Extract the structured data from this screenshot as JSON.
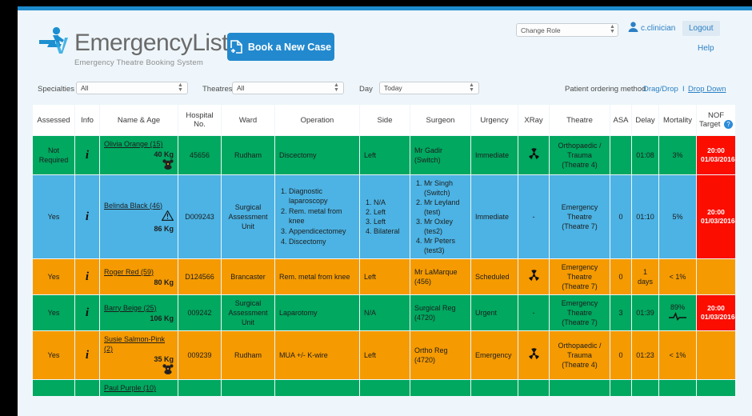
{
  "brand": {
    "name_part1": "Emergency",
    "name_part2": "List",
    "tagline": "Emergency Theatre Booking System",
    "accent_color": "#1e8bcd"
  },
  "header": {
    "book_button": "Book a New Case",
    "role_select_value": "Change Role",
    "username": "c.clinician",
    "logout_label": "Logout",
    "help_label": "Help"
  },
  "filters": {
    "specialties_label": "Specialties",
    "specialties_value": "All",
    "theatres_label": "Theatres",
    "theatres_value": "All",
    "day_label": "Day",
    "day_value": "Today",
    "ordering_label": "Patient ordering method",
    "ordering_dragdrop": "Drag/Drop",
    "ordering_separator": "I",
    "ordering_dropdown": "Drop Down"
  },
  "table": {
    "columns": [
      "Assessed",
      "Info",
      "Name & Age",
      "Hospital No.",
      "Ward",
      "Operation",
      "Side",
      "Surgeon",
      "Urgency",
      "XRay",
      "Theatre",
      "ASA",
      "Delay",
      "Mortality",
      "NOF Target"
    ],
    "rows": [
      {
        "color": "green",
        "assessed": "Not Required",
        "info_icon": "info-italic-i",
        "name": "Olivia Orange (15)",
        "weight": "40 Kg",
        "flag_icon": "teddy-bear-icon",
        "hospital_no": "45656",
        "ward": "Rudham",
        "operation": "Discectomy",
        "side": "Left",
        "surgeon": "Mr Gadir (Switch)",
        "urgency": "Immediate",
        "xray": "radiation-icon",
        "theatre": "Orthopaedic / Trauma (Theatre 4)",
        "asa": "",
        "delay": "01:08",
        "mortality": "3%",
        "mortality_icon": "",
        "nof_target": "20:00 01/03/2016",
        "nof_time": "20:00",
        "nof_date": "01/03/2016"
      },
      {
        "color": "blue",
        "assessed": "Yes",
        "info_icon": "info-italic-i",
        "name": "Belinda Black (46)",
        "weight": "86 Kg",
        "flag_icon": "warning-triangle-icon",
        "hospital_no": "D009243",
        "ward": "Surgical Assessment Unit",
        "operations": [
          "Diagnostic laparoscopy",
          "Rem. metal from knee",
          "Appendicectomey",
          "Discectomy"
        ],
        "sides": [
          "N/A",
          "Left",
          "Left",
          "Bilateral"
        ],
        "surgeons": [
          "Mr Singh (Switch)",
          "Mr Leyland (test)",
          "Mr Oxley (tes2)",
          "Mr Peters (test3)"
        ],
        "urgency": "Immediate",
        "xray": "-",
        "theatre": "Emergency Theatre (Theatre 7)",
        "asa": "0",
        "delay": "01:10",
        "mortality": "5%",
        "mortality_icon": "",
        "nof_time": "20:00",
        "nof_date": "01/03/2016"
      },
      {
        "color": "orange",
        "assessed": "Yes",
        "info_icon": "info-italic-i",
        "name": "Roger Red (59)",
        "weight": "80 Kg",
        "flag_icon": "",
        "hospital_no": "D124566",
        "ward": "Brancaster",
        "operation": "Rem. metal from knee",
        "side": "Left",
        "surgeon": "Mr LaMarque (456)",
        "urgency": "Scheduled",
        "xray": "radiation-icon",
        "theatre": "Emergency Theatre (Theatre 7)",
        "asa": "0",
        "delay": "1 days",
        "mortality": "< 1%",
        "mortality_icon": "",
        "nof_time": "",
        "nof_date": ""
      },
      {
        "color": "green",
        "assessed": "Yes",
        "info_icon": "info-italic-i",
        "name": "Barry Beige (25)",
        "weight": "106 Kg",
        "flag_icon": "",
        "hospital_no": "009242",
        "ward": "Surgical Assessment Unit",
        "operation": "Laparotomy",
        "side": "N/A",
        "surgeon": "Surgical Reg (4720)",
        "urgency": "Urgent",
        "xray": "-",
        "theatre": "Emergency Theatre (Theatre 7)",
        "asa": "3",
        "delay": "01:39",
        "mortality": "89%",
        "mortality_icon": "ecg-heartbeat-icon",
        "nof_time": "20:00",
        "nof_date": "01/03/2016"
      },
      {
        "color": "orange",
        "assessed": "Yes",
        "info_icon": "info-italic-i",
        "name": "Susie Salmon-Pink (2)",
        "weight": "35 Kg",
        "flag_icon": "teddy-bear-icon",
        "hospital_no": "009239",
        "ward": "Rudham",
        "operation": "MUA +/- K-wire",
        "side": "Left",
        "surgeon": "Ortho Reg (4720)",
        "urgency": "Emergency",
        "xray": "radiation-icon",
        "theatre": "Orthopaedic / Trauma (Theatre 4)",
        "asa": "0",
        "delay": "01:23",
        "mortality": "< 1%",
        "mortality_icon": "",
        "nof_time": "",
        "nof_date": ""
      },
      {
        "color": "green",
        "assessed": "",
        "info_icon": "",
        "name": "Paul Purple (10)",
        "weight": "",
        "flag_icon": "",
        "hospital_no": "",
        "ward": "",
        "operation": "",
        "side": "",
        "surgeon": "",
        "urgency": "",
        "xray": "",
        "theatre": "",
        "asa": "",
        "delay": "",
        "mortality": "",
        "nof_time": "",
        "nof_date": ""
      }
    ]
  },
  "colors": {
    "row_green": "#00a860",
    "row_blue": "#4cb3e4",
    "row_orange": "#f59a00",
    "nof_red": "#fb0d00",
    "link_blue": "#2b7fc4",
    "page_bg": "#eef6fb"
  }
}
